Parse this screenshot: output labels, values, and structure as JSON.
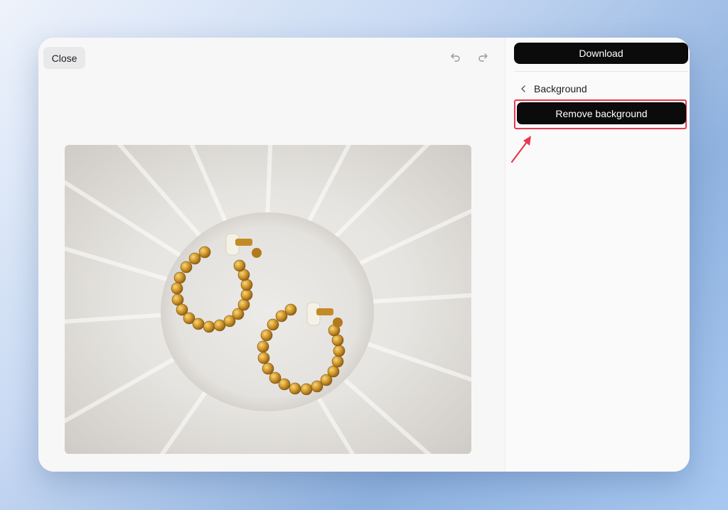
{
  "toolbar": {
    "close_label": "Close",
    "undo_icon": "undo-icon",
    "redo_icon": "redo-icon"
  },
  "canvas": {
    "image_subject": "gold-beaded-hoop-earrings-on-white-fluted-dish"
  },
  "side_panel": {
    "download_label": "Download",
    "section": {
      "back_icon": "chevron-left-icon",
      "title": "Background"
    },
    "remove_background_label": "Remove background"
  },
  "colors": {
    "primary_button": "#0b0b0b",
    "highlight": "#e8384f",
    "window_bg": "#f7f7f8"
  }
}
